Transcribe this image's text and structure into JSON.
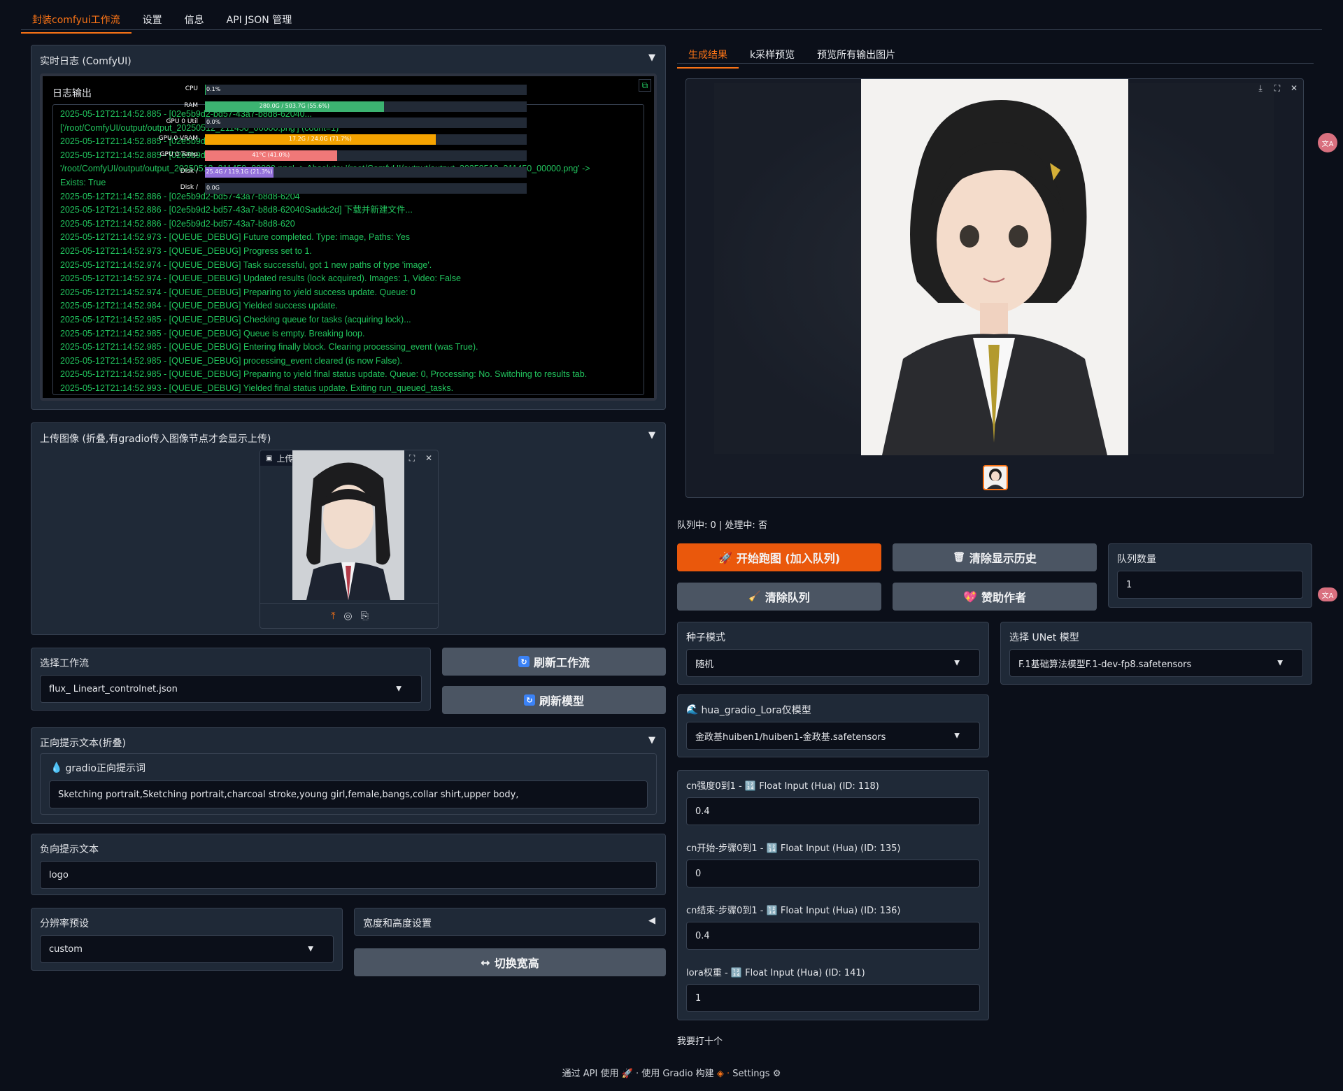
{
  "tabs": [
    {
      "label": "封装comfyui工作流",
      "active": true
    },
    {
      "label": "设置",
      "active": false
    },
    {
      "label": "信息",
      "active": false
    },
    {
      "label": "API JSON 管理",
      "active": false
    }
  ],
  "log_panel": {
    "title": "实时日志 (ComfyUI)",
    "inner_title": "日志输出",
    "lines": [
      "2025-05-12T21:14:52.885 - [02e5b9d2-bd57-43a7-b8d8-62040...",
      "['/root/ComfyUI/output/output_20250512_211450_00000.png'] (count=1)",
      "2025-05-12T21:14:52.885 - [02e5b9d2-bd57-43a7-b8d8-62040",
      "2025-05-12T21:14:52.885 - [02e5b9d2-bd57-43a7-b8d8-62040Faddc2d] Validating path 1/1:",
      "'/root/ComfyUI/output/output_20250512_211450_00000.png' -> Absolute: '/root/ComfyUI/output/output_20250512_211450_00000.png' ->",
      "Exists: True",
      "2025-05-12T21:14:52.886 - [02e5b9d2-bd57-43a7-b8d8-6204",
      "2025-05-12T21:14:52.886 - [02e5b9d2-bd57-43a7-b8d8-62040Saddc2d] 下载并新建文件...",
      "2025-05-12T21:14:52.886 - [02e5b9d2-bd57-43a7-b8d8-620",
      "2025-05-12T21:14:52.973 - [QUEUE_DEBUG] Future completed. Type: image, Paths: Yes",
      "2025-05-12T21:14:52.973 - [QUEUE_DEBUG] Progress set to 1.",
      "2025-05-12T21:14:52.974 - [QUEUE_DEBUG] Task successful, got 1 new paths of type 'image'.",
      "2025-05-12T21:14:52.974 - [QUEUE_DEBUG] Updated results (lock acquired). Images: 1, Video: False",
      "2025-05-12T21:14:52.974 - [QUEUE_DEBUG] Preparing to yield success update. Queue: 0",
      "2025-05-12T21:14:52.984 - [QUEUE_DEBUG] Yielded success update.",
      "2025-05-12T21:14:52.985 - [QUEUE_DEBUG] Checking queue for tasks (acquiring lock)...",
      "2025-05-12T21:14:52.985 - [QUEUE_DEBUG] Queue is empty. Breaking loop.",
      "2025-05-12T21:14:52.985 - [QUEUE_DEBUG] Entering finally block. Clearing processing_event (was True).",
      "2025-05-12T21:14:52.985 - [QUEUE_DEBUG] processing_event cleared (is now False).",
      "2025-05-12T21:14:52.985 - [QUEUE_DEBUG] Preparing to yield final status update. Queue: 0, Processing: No. Switching to results tab.",
      "2025-05-12T21:14:52.993 - [QUEUE_DEBUG] Yielded final status update. Exiting run_queued_tasks."
    ]
  },
  "monitor": [
    {
      "label": "CPU",
      "text": "0.1%",
      "fraction": 0.001,
      "color": "#22c55e"
    },
    {
      "label": "RAM",
      "text": "280.0G / 503.7G (55.6%)",
      "fraction": 0.556,
      "color": "#3cb371"
    },
    {
      "label": "GPU 0 Util",
      "text": "0.0%",
      "fraction": 0.0,
      "color": "#22c55e"
    },
    {
      "label": "GPU 0 VRAM",
      "text": "17.2G / 24.0G (71.7%)",
      "fraction": 0.717,
      "color": "#f5a300"
    },
    {
      "label": "GPU 0 Temp",
      "text": "41°C (41.0%)",
      "fraction": 0.41,
      "color": "#f07878"
    },
    {
      "label": "Disk /",
      "text": "25.4G / 119.1G (21.3%)",
      "fraction": 0.213,
      "color": "#9370db"
    },
    {
      "label": "Disk /",
      "text": "0.0G",
      "fraction": 0.0,
      "color": "#9370db"
    }
  ],
  "upload_panel": {
    "title": "上传图像 (折叠,有gradio传入图像节点才会显示上传)",
    "image_label": "上传图像"
  },
  "workflow": {
    "label": "选择工作流",
    "value": "flux_ Lineart_controlnet.json",
    "refresh_workflow": "刷新工作流",
    "refresh_model": "刷新模型"
  },
  "positive": {
    "title": "正向提示文本(折叠)",
    "sub_label": "gradio正向提示词",
    "value": "Sketching  portrait,Sketching  portrait,charcoal stroke,young girl,female,bangs,collar shirt,upper body,"
  },
  "negative": {
    "title": "负向提示文本",
    "value": "logo"
  },
  "resolution": {
    "label": "分辨率预设",
    "value": "custom",
    "wh_title": "宽度和高度设置",
    "swap_button": "切换宽高"
  },
  "output_tabs": [
    {
      "label": "生成结果",
      "active": true
    },
    {
      "label": "k采样预览",
      "active": false
    },
    {
      "label": "预览所有输出图片",
      "active": false
    }
  ],
  "status_text": "队列中: 0 | 处理中: 否",
  "buttons": {
    "start": "开始跑图 (加入队列)",
    "clear_history": "清除显示历史",
    "clear_queue": "清除队列",
    "sponsor": "赞助作者"
  },
  "queue_count": {
    "label": "队列数量",
    "value": "1"
  },
  "seed": {
    "label": "种子模式",
    "value": "随机"
  },
  "unet": {
    "label": "选择 UNet 模型",
    "value": "F.1基础算法模型F.1-dev-fp8.safetensors"
  },
  "lora": {
    "label": "hua_gradio_Lora仅模型",
    "value": "金政基huiben1/huiben1-金政基.safetensors"
  },
  "float_inputs": [
    {
      "label": "cn强度0到1 - 🔢 Float Input (Hua) (ID: 118)",
      "value": "0.4"
    },
    {
      "label": "cn开始-步骤0到1 - 🔢 Float Input (Hua) (ID: 135)",
      "value": "0"
    },
    {
      "label": "cn结束-步骤0到1 - 🔢 Float Input (Hua) (ID: 136)",
      "value": "0.4"
    },
    {
      "label": "lora权重 - 🔢 Float Input (Hua) (ID: 141)",
      "value": "1"
    }
  ],
  "bottom_note": "我要打十个",
  "footer": {
    "api": "通过 API 使用",
    "gradio": "使用 Gradio 构建",
    "settings": "Settings"
  },
  "colors": {
    "accent": "#ea580c",
    "log_green": "#22c55e",
    "panel": "#1f2937",
    "background": "#0b0f19"
  }
}
